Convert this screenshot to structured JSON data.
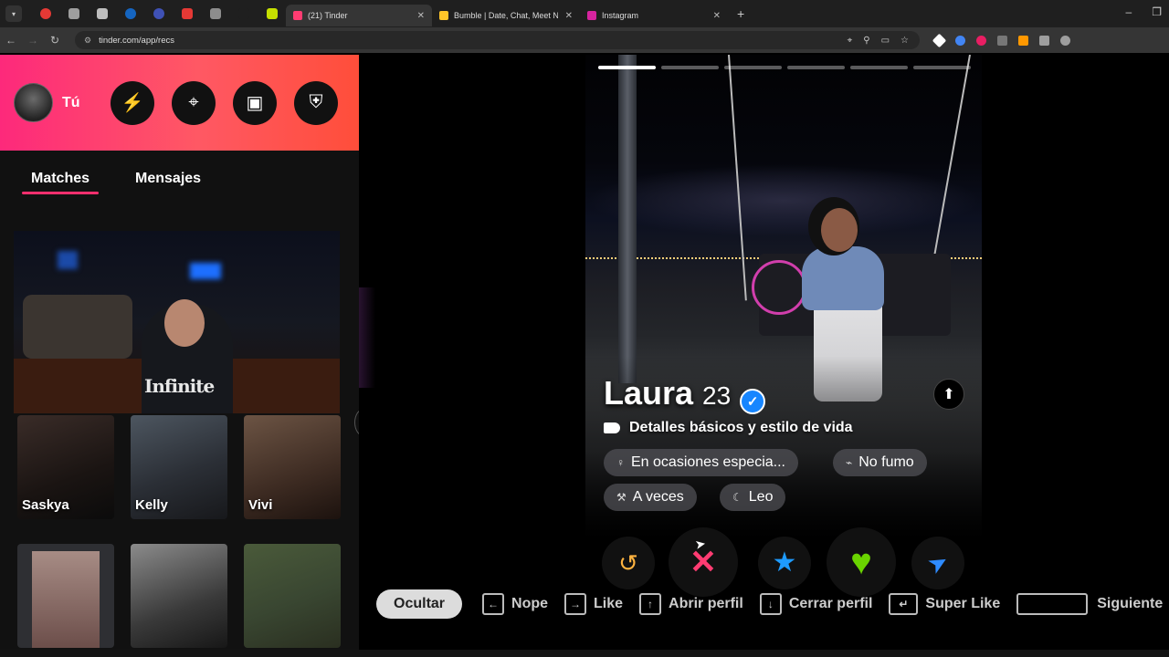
{
  "browser": {
    "tabs": [
      {
        "title": "(21) Tinder",
        "active": true,
        "favicon_color": "#fe3c72"
      },
      {
        "title": "Bumble | Date, Chat, Meet New",
        "active": false,
        "favicon_color": "#ffc629"
      },
      {
        "title": "Instagram",
        "active": false,
        "favicon_color": "#d6249f"
      }
    ],
    "close_glyph": "✕",
    "new_tab_glyph": "+",
    "url": "tinder.com/app/recs"
  },
  "sidebar": {
    "user_label": "Tú",
    "header_buttons": [
      {
        "icon": "lightning-icon",
        "glyph": "⚡",
        "color": "#9b4dff"
      },
      {
        "icon": "compass-icon",
        "glyph": "⌖",
        "color": "#ffffff"
      },
      {
        "icon": "briefcase-icon",
        "glyph": "▣",
        "color": "#ffffff"
      },
      {
        "icon": "shield-icon",
        "glyph": "⛨",
        "color": "#ffffff"
      }
    ],
    "tabs": [
      {
        "label": "Matches",
        "active": true
      },
      {
        "label": "Mensajes",
        "active": false
      }
    ],
    "video_text": "Infinite",
    "matches": [
      {
        "name": "Saskya"
      },
      {
        "name": "Kelly"
      },
      {
        "name": "Vivi"
      },
      {
        "name": ""
      },
      {
        "name": ""
      },
      {
        "name": ""
      }
    ]
  },
  "profile": {
    "name": "Laura",
    "age": "23",
    "verified": true,
    "photo_count": 6,
    "current_photo": 1,
    "details_label": "Detalles básicos y estilo de vida",
    "chips": [
      {
        "icon": "drink-icon",
        "glyph": "♀",
        "label": "En ocasiones especia..."
      },
      {
        "icon": "smoking-icon",
        "glyph": "⌁",
        "label": "No fumo"
      },
      {
        "icon": "exercise-icon",
        "glyph": "⚒",
        "label": "A veces"
      },
      {
        "icon": "zodiac-icon",
        "glyph": "☾",
        "label": "Leo"
      }
    ]
  },
  "actions": [
    {
      "name": "rewind",
      "glyph": "↺",
      "color": "#ffb340"
    },
    {
      "name": "nope",
      "glyph": "✕",
      "color": "#fe3c72"
    },
    {
      "name": "super-like",
      "glyph": "★",
      "color": "#1e9bff"
    },
    {
      "name": "like",
      "glyph": "♥",
      "color": "#6ad400"
    },
    {
      "name": "boost",
      "glyph": "➤",
      "color": "#2e8bff"
    }
  ],
  "shortcuts": {
    "hide_label": "Ocultar",
    "items": [
      {
        "key": "←",
        "label": "Nope"
      },
      {
        "key": "→",
        "label": "Like"
      },
      {
        "key": "↑",
        "label": "Abrir perfil"
      },
      {
        "key": "↓",
        "label": "Cerrar perfil"
      },
      {
        "key": "↵",
        "label": "Super Like"
      }
    ],
    "next_label": "Siguiente"
  },
  "colors": {
    "brand_gradient_start": "#fd297b",
    "brand_gradient_end": "#ff4e3a",
    "verified_blue": "#1786ff"
  }
}
